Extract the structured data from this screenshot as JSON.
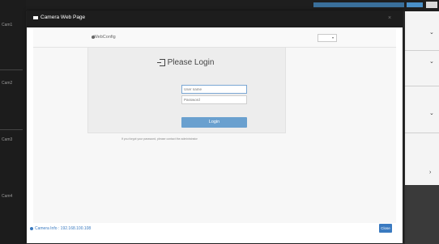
{
  "background": {
    "camera_labels": [
      "Cam1",
      "Cam2",
      "Cam3",
      "Cam4"
    ]
  },
  "modal": {
    "title": "Camera Web Page",
    "close_label": "×"
  },
  "topbar": {
    "webconfig_label": "WebConfig",
    "language_caret": "▾"
  },
  "login": {
    "title": "Please Login",
    "username_placeholder": "User name",
    "password_placeholder": "Password",
    "login_button": "Login",
    "hint": "If you forgot your password, please contact the administrator"
  },
  "footer": {
    "status": "Camera Info : 192.168.100.108",
    "button": "Close"
  }
}
